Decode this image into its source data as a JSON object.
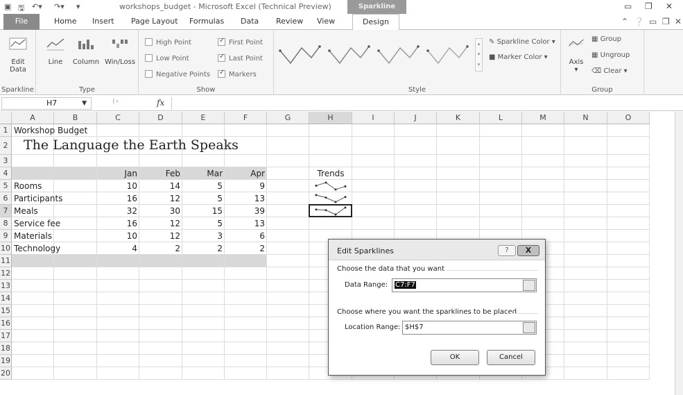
{
  "titlebar": {
    "title": "workshops_budget - Microsoft Excel (Technical Preview)",
    "context_tab": "Sparkline Tools"
  },
  "tabs": {
    "file": "File",
    "home": "Home",
    "insert": "Insert",
    "page_layout": "Page Layout",
    "formulas": "Formulas",
    "data": "Data",
    "review": "Review",
    "view": "View",
    "design": "Design"
  },
  "ribbon": {
    "sparkline_group": {
      "edit_data": "Edit Data",
      "label": "Sparkline"
    },
    "type_group": {
      "line": "Line",
      "column": "Column",
      "winloss": "Win/Loss",
      "label": "Type"
    },
    "show_group": {
      "label": "Show",
      "items": [
        {
          "text": "High Point",
          "checked": false
        },
        {
          "text": "Low Point",
          "checked": false
        },
        {
          "text": "Negative Points",
          "checked": false
        },
        {
          "text": "First Point",
          "checked": true
        },
        {
          "text": "Last Point",
          "checked": true
        },
        {
          "text": "Markers",
          "checked": true
        }
      ]
    },
    "style_group": {
      "label": "Style",
      "sparkline_color": "Sparkline Color",
      "marker_color": "Marker Color"
    },
    "group_group": {
      "axis": "Axis",
      "group": "Group",
      "ungroup": "Ungroup",
      "clear": "Clear",
      "label": "Group"
    }
  },
  "formula_bar": {
    "name_box": "H7",
    "fx": "fx",
    "formula": ""
  },
  "columns": [
    "A",
    "B",
    "C",
    "D",
    "E",
    "F",
    "G",
    "H",
    "I",
    "J",
    "K",
    "L",
    "M",
    "N",
    "O"
  ],
  "rows": [
    "1",
    "2",
    "3",
    "4",
    "5",
    "6",
    "7",
    "8",
    "9",
    "10",
    "11",
    "12",
    "13",
    "14",
    "15",
    "16",
    "17",
    "18",
    "19",
    "20"
  ],
  "sheet": {
    "a1": "Workshop Budget",
    "a2": "The Language the Earth Speaks",
    "month_headers": [
      "Jan",
      "Feb",
      "Mar",
      "Apr"
    ],
    "trends_header": "Trends",
    "data_rows": [
      {
        "label": "Rooms",
        "values": [
          "10",
          "14",
          "5",
          "9"
        ]
      },
      {
        "label": "Participants",
        "values": [
          "16",
          "12",
          "5",
          "13"
        ]
      },
      {
        "label": "Meals",
        "values": [
          "32",
          "30",
          "15",
          "39"
        ]
      },
      {
        "label": "Service fee",
        "values": [
          "16",
          "12",
          "5",
          "13"
        ]
      },
      {
        "label": "Materials",
        "values": [
          "10",
          "12",
          "3",
          "6"
        ]
      },
      {
        "label": "Technology",
        "values": [
          "4",
          "2",
          "2",
          "2"
        ]
      }
    ],
    "sparklines": [
      [
        10,
        14,
        5,
        9
      ],
      [
        16,
        12,
        5,
        13
      ],
      [
        32,
        30,
        15,
        39
      ]
    ]
  },
  "dialog": {
    "title": "Edit Sparklines",
    "help": "?",
    "close": "X",
    "section1": "Choose the data that you want",
    "data_range_label": "Data Range:",
    "data_range_value": "C7:F7",
    "section2": "Choose where you want the sparklines to be placed",
    "location_range_label": "Location Range:",
    "location_range_value": "$H$7",
    "ok": "OK",
    "cancel": "Cancel"
  }
}
